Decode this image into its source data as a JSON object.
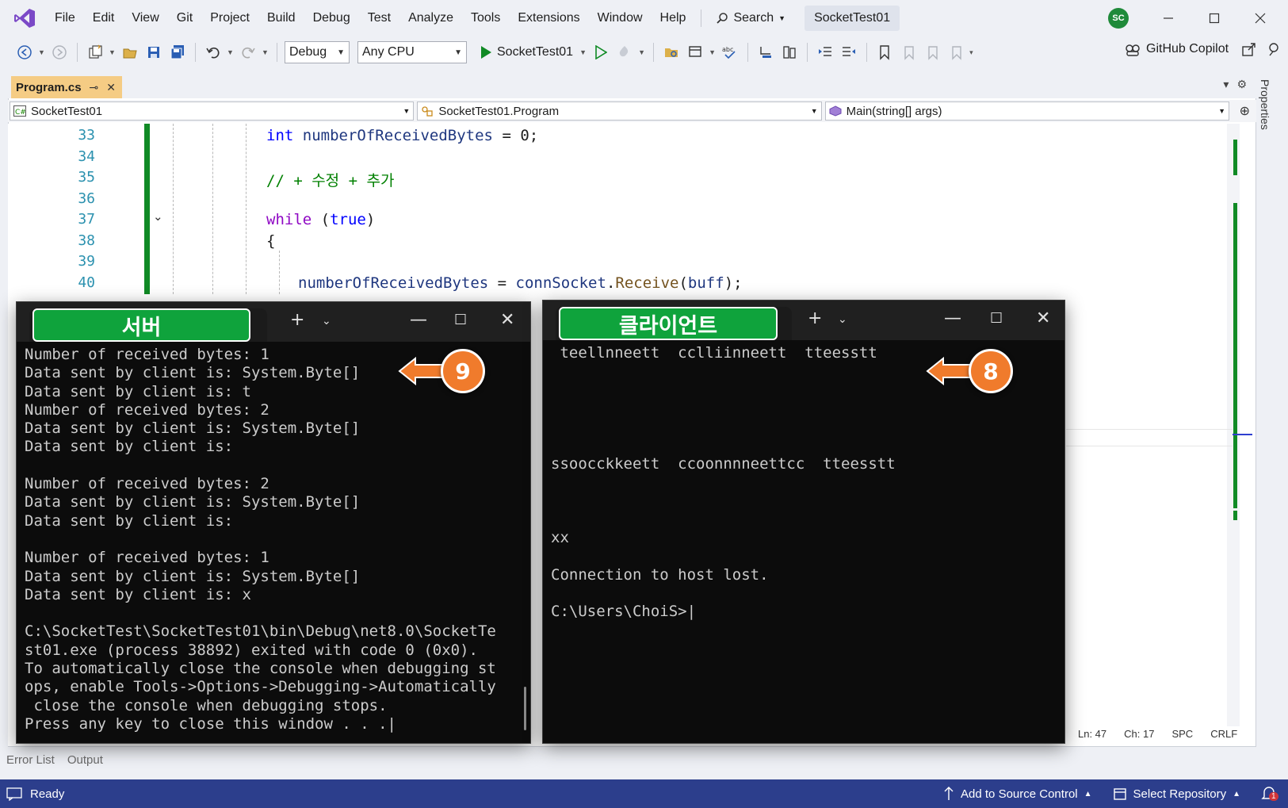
{
  "menu": {
    "items": [
      "File",
      "Edit",
      "View",
      "Git",
      "Project",
      "Build",
      "Debug",
      "Test",
      "Analyze",
      "Tools",
      "Extensions",
      "Window",
      "Help"
    ],
    "search_label": "Search",
    "solution_name": "SocketTest01",
    "avatar_initials": "SC"
  },
  "toolbar": {
    "config": "Debug",
    "platform": "Any CPU",
    "run_target": "SocketTest01",
    "copilot": "GitHub Copilot"
  },
  "editor": {
    "tab_title": "Program.cs",
    "nav_project": "SocketTest01",
    "nav_class": "SocketTest01.Program",
    "nav_member": "Main(string[] args)",
    "properties_label": "Properties",
    "lines": [
      {
        "num": "33",
        "tokens": [
          {
            "t": "int",
            "c": "kw"
          },
          {
            "t": " ",
            "c": ""
          },
          {
            "t": "numberOfReceivedBytes",
            "c": "var"
          },
          {
            "t": " = 0;",
            "c": ""
          }
        ]
      },
      {
        "num": "34",
        "tokens": []
      },
      {
        "num": "35",
        "tokens": [
          {
            "t": "// + 수정 + 추가",
            "c": "cmt"
          }
        ]
      },
      {
        "num": "36",
        "tokens": []
      },
      {
        "num": "37",
        "tokens": [
          {
            "t": "while",
            "c": "ctl"
          },
          {
            "t": " (",
            "c": ""
          },
          {
            "t": "true",
            "c": "kw"
          },
          {
            "t": ")",
            "c": ""
          }
        ]
      },
      {
        "num": "38",
        "tokens": [
          {
            "t": "{",
            "c": ""
          }
        ]
      },
      {
        "num": "39",
        "tokens": []
      },
      {
        "num": "40",
        "tokens": [
          {
            "t": "numberOfReceivedBytes",
            "c": "var"
          },
          {
            "t": " = ",
            "c": ""
          },
          {
            "t": "connSocket",
            "c": "var"
          },
          {
            "t": ".",
            "c": ""
          },
          {
            "t": "Receive",
            "c": "meth"
          },
          {
            "t": "(",
            "c": ""
          },
          {
            "t": "buff",
            "c": "var"
          },
          {
            "t": ");",
            "c": ""
          }
        ]
      }
    ],
    "status": {
      "ln": "Ln: 47",
      "ch": "Ch: 17",
      "spc": "SPC",
      "crlf": "CRLF"
    }
  },
  "server_console": {
    "tab_label": "서버",
    "callout": "9",
    "lines": [
      "Number of received bytes: 1",
      "Data sent by client is: System.Byte[]",
      "Data sent by client is: t",
      "Number of received bytes: 2",
      "Data sent by client is: System.Byte[]",
      "Data sent by client is:",
      "",
      "Number of received bytes: 2",
      "Data sent by client is: System.Byte[]",
      "Data sent by client is:",
      "",
      "Number of received bytes: 1",
      "Data sent by client is: System.Byte[]",
      "Data sent by client is: x",
      "",
      "C:\\SocketTest\\SocketTest01\\bin\\Debug\\net8.0\\SocketTe",
      "st01.exe (process 38892) exited with code 0 (0x0).",
      "To automatically close the console when debugging st",
      "ops, enable Tools->Options->Debugging->Automatically",
      " close the console when debugging stops.",
      "Press any key to close this window . . .|"
    ]
  },
  "client_console": {
    "tab_label": "클라이언트",
    "callout": "8",
    "lines": [
      " teellnneett  cclliinneett  tteesstt",
      "",
      "",
      "",
      "",
      "",
      "ssoocckkeett  ccoonnnneettcc  tteesstt",
      "",
      "",
      "",
      "xx",
      "",
      "Connection to host lost.",
      "",
      "C:\\Users\\ChoiS>|"
    ]
  },
  "bottom": {
    "tabs": [
      "Error List",
      "Output"
    ],
    "ready": "Ready",
    "add_source": "Add to Source Control",
    "select_repo": "Select Repository",
    "notif_count": "1"
  },
  "colors": {
    "accent_blue": "#2c3e8c",
    "tab_highlight": "#f5cc84",
    "console_label_green": "#0fa33c",
    "callout_orange": "#f07b2c"
  }
}
